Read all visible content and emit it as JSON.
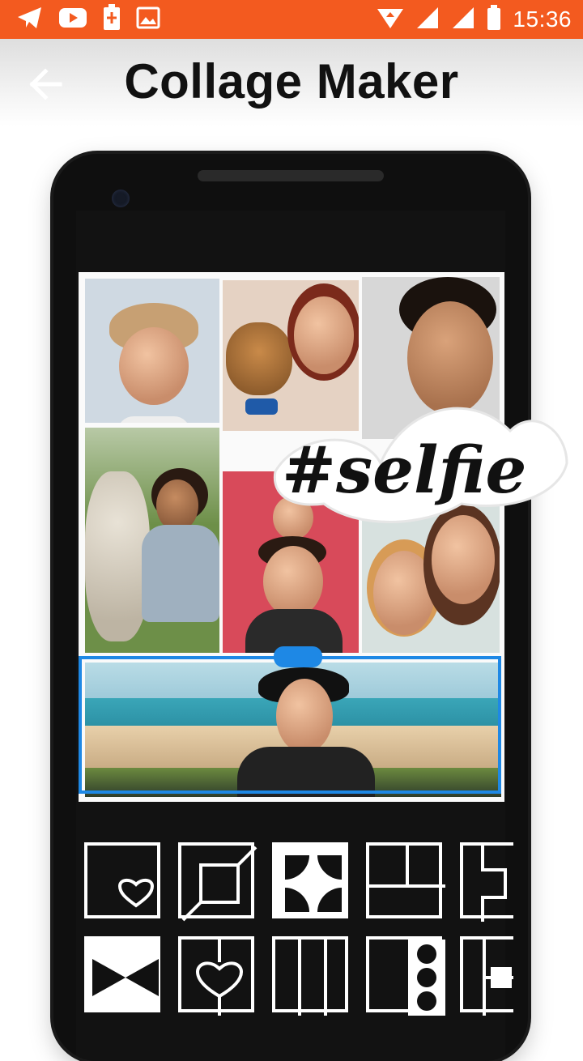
{
  "status_bar": {
    "time": "15:36",
    "icons_left": [
      "telegram-icon",
      "youtube-icon",
      "battery-saver-icon",
      "image-icon"
    ],
    "icons_right": [
      "data-saver-icon",
      "signal-icon",
      "signal-icon-2",
      "battery-icon"
    ],
    "color": "#f35a1f"
  },
  "header": {
    "title": "Collage Maker",
    "back_icon": "arrow-left-icon"
  },
  "collage": {
    "sticker_text": "#selfie",
    "selected_cell": "bottom-panorama"
  },
  "templates": {
    "row1": [
      "heart-frame",
      "diagonal-frame",
      "flower-grid",
      "three-panel",
      "side-slots"
    ],
    "row2": [
      "bow-tie",
      "heart-cutout",
      "three-columns",
      "dot-column",
      "cross-grid"
    ]
  },
  "colors": {
    "accent": "#1e88e5",
    "status": "#f35a1f",
    "phone": "#0f0f0f"
  }
}
